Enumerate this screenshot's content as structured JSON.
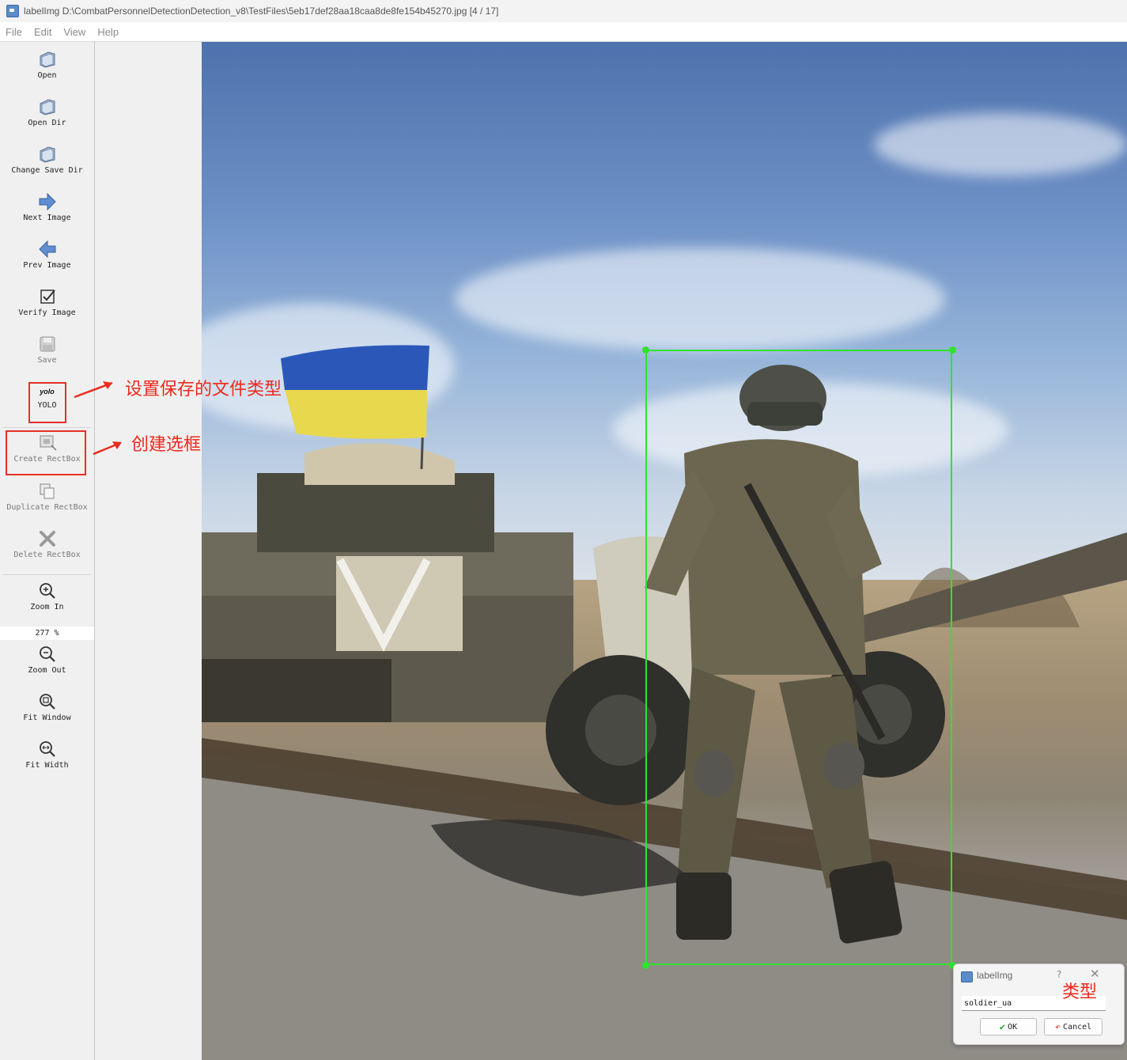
{
  "window": {
    "title": "labelImg D:\\CombatPersonnelDetectionDetection_v8\\TestFiles\\5eb17def28aa18caa8de8fe154b45270.jpg [4 / 17]"
  },
  "menubar": {
    "items": [
      {
        "label": "File"
      },
      {
        "label": "Edit"
      },
      {
        "label": "View"
      },
      {
        "label": "Help"
      }
    ]
  },
  "toolbar": {
    "open": "Open",
    "open_dir": "Open Dir",
    "change_save_dir": "Change Save Dir",
    "next_image": "Next Image",
    "prev_image": "Prev Image",
    "verify_image": "Verify Image",
    "save": "Save",
    "yolo_small": "yolo",
    "yolo": "YOLO",
    "create_rectbox": "Create RectBox",
    "duplicate_rectbox": "Duplicate RectBox",
    "delete_rectbox": "Delete RectBox",
    "zoom_in": "Zoom In",
    "zoom_value": "277 %",
    "zoom_out": "Zoom Out",
    "fit_window": "Fit Window",
    "fit_width": "Fit Width"
  },
  "annotations": {
    "save_format_note": "设置保存的文件类型",
    "create_box_note": "创建选框",
    "type_note": "类型"
  },
  "label_dialog": {
    "title": "labelImg",
    "help": "?",
    "close": "✕",
    "input_value": "soldier_ua",
    "ok_label": "OK",
    "cancel_label": "Cancel"
  },
  "colors": {
    "bbox": "#2fe32f",
    "annotation_red": "#ee2a1e"
  }
}
